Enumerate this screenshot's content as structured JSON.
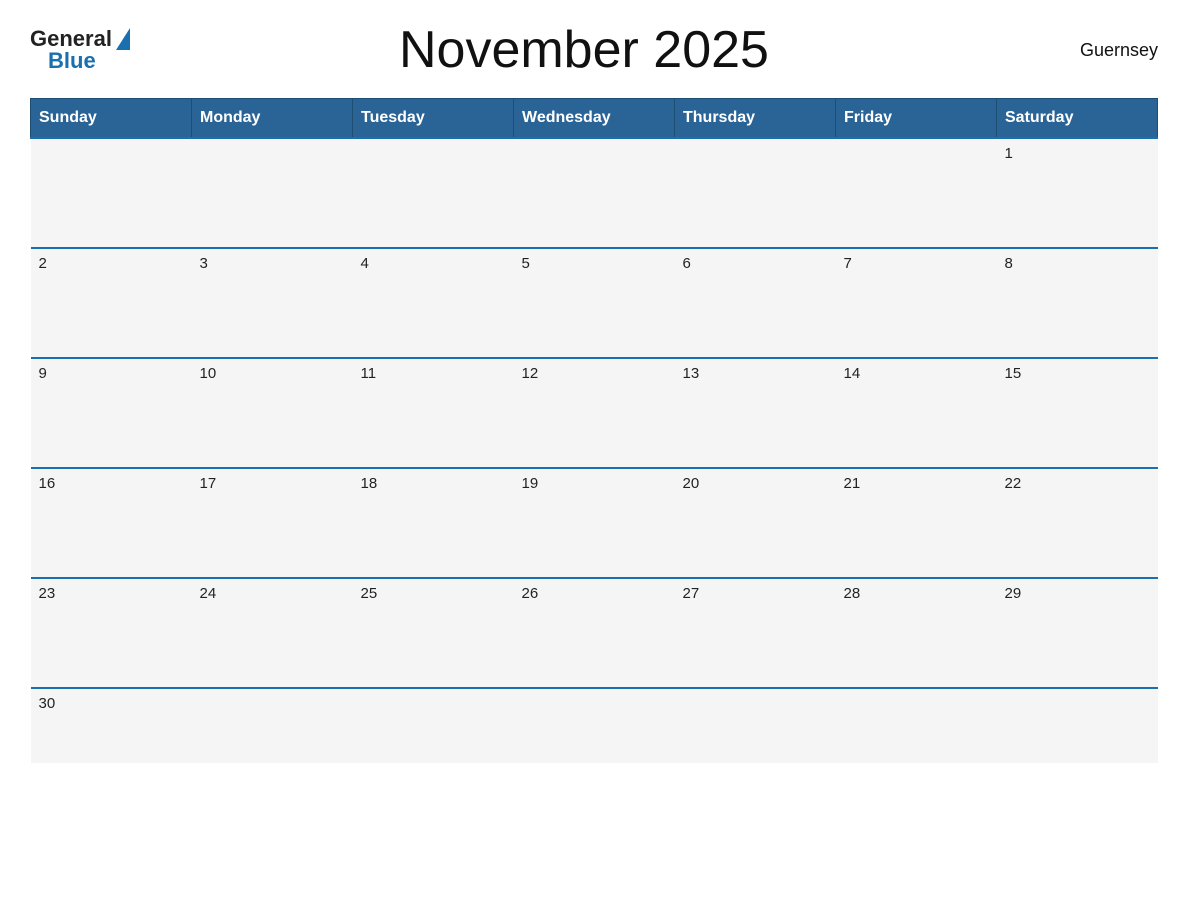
{
  "header": {
    "logo_general": "General",
    "logo_blue": "Blue",
    "title": "November 2025",
    "country": "Guernsey"
  },
  "calendar": {
    "days_of_week": [
      "Sunday",
      "Monday",
      "Tuesday",
      "Wednesday",
      "Thursday",
      "Friday",
      "Saturday"
    ],
    "weeks": [
      [
        null,
        null,
        null,
        null,
        null,
        null,
        1
      ],
      [
        2,
        3,
        4,
        5,
        6,
        7,
        8
      ],
      [
        9,
        10,
        11,
        12,
        13,
        14,
        15
      ],
      [
        16,
        17,
        18,
        19,
        20,
        21,
        22
      ],
      [
        23,
        24,
        25,
        26,
        27,
        28,
        29
      ],
      [
        30,
        null,
        null,
        null,
        null,
        null,
        null
      ]
    ]
  }
}
